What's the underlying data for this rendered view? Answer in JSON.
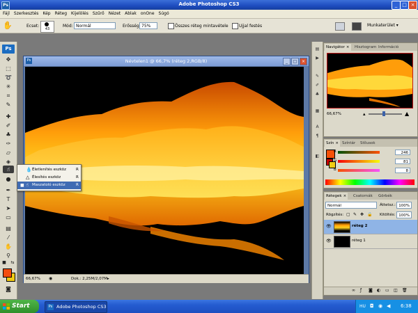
{
  "app": {
    "title": "Adobe Photoshop CS3",
    "icon_text": "Ps"
  },
  "menu": [
    "Fájl",
    "Szerkesztés",
    "Kép",
    "Réteg",
    "Kijelölés",
    "Szűrő",
    "Nézet",
    "Ablak",
    "onOne",
    "Súgó"
  ],
  "options_bar": {
    "brush_label": "Ecset:",
    "brush_size": "43",
    "mode_label": "Mód:",
    "mode_value": "Normál",
    "strength_label": "Erősség:",
    "strength_value": "75%",
    "sample_all_label": "Összes réteg mintavétele",
    "finger_paint_label": "Ujjal festés",
    "workspace_label": "Munkaterület"
  },
  "toolbox": {
    "logo": "Ps"
  },
  "document": {
    "title": "Névtelen1 @ 66,7% (réteg 2,RGB/8)",
    "zoom": "66,67%",
    "doc_info": "Dok.: 2,25M/2,07M"
  },
  "tool_flyout": [
    {
      "name": "Életlenítés eszköz",
      "shortcut": "R",
      "selected": false
    },
    {
      "name": "Élesítés eszköz",
      "shortcut": "R",
      "selected": false
    },
    {
      "name": "Maszatoló eszköz",
      "shortcut": "R",
      "selected": true
    }
  ],
  "navigator_panel": {
    "tabs": [
      "Navigátor",
      "Hisztogram",
      "Információ"
    ],
    "zoom": "66,67%"
  },
  "color_panel": {
    "tabs": [
      "Szín",
      "Színtár",
      "Stílusok"
    ],
    "channels": [
      {
        "label": "R",
        "value": "246"
      },
      {
        "label": "G",
        "value": "81"
      },
      {
        "label": "B",
        "value": "8"
      }
    ],
    "fg_color": "#f65108"
  },
  "layers_panel": {
    "tabs": [
      "Rétegek",
      "Csatornák",
      "Görbék"
    ],
    "blend_mode": "Normál",
    "opacity_label": "Áttetsz.:",
    "opacity_value": "100%",
    "lock_label": "Rögzítés:",
    "fill_label": "Kitöltés:",
    "fill_value": "100%",
    "layers": [
      {
        "name": "réteg 2",
        "selected": true
      },
      {
        "name": "réteg 1",
        "selected": false
      }
    ]
  },
  "taskbar": {
    "start_label": "Start",
    "task_label": "Adobe Photoshop CS3",
    "lang": "HU",
    "clock": "6:38"
  }
}
